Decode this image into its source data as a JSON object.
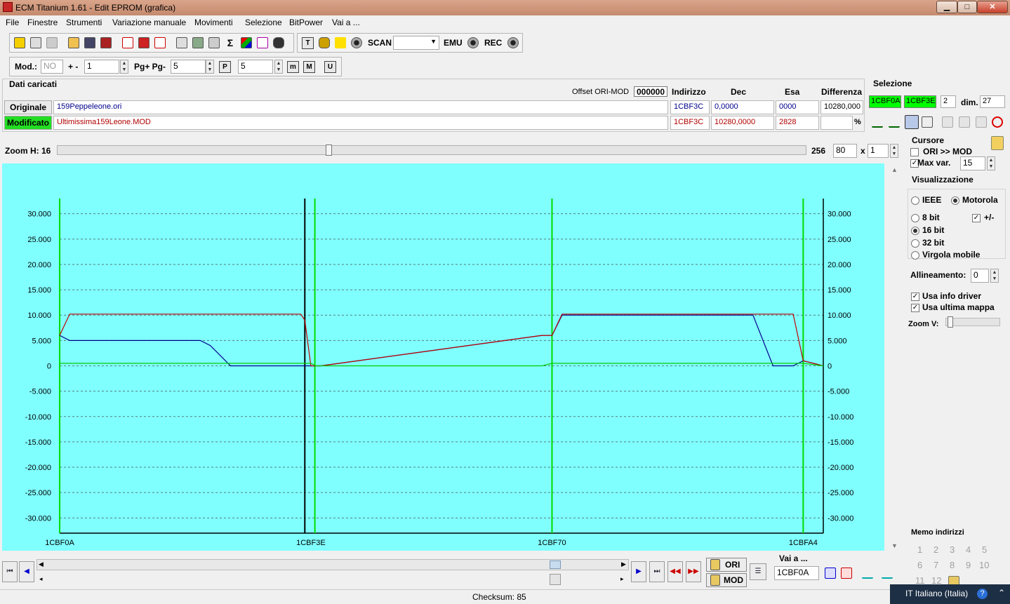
{
  "window": {
    "title": "ECM Titanium 1.61 - Edit EPROM (grafica)",
    "min": "▁",
    "max": "□",
    "close": "✕"
  },
  "menu": [
    "File",
    "Finestre",
    "Strumenti",
    "Variazione manuale",
    "Movimenti",
    "Selezione",
    "BitPower",
    "Vai a ..."
  ],
  "toolbar": {
    "scan": "SCAN",
    "emu": "EMU",
    "rec": "REC"
  },
  "toolbar2": {
    "mod_label": "Mod.:",
    "mod_value": "NO",
    "pm_label": "+ -",
    "pm_value": "1",
    "pg_label": "Pg+ Pg-",
    "pg_value": "5",
    "p_value": "5"
  },
  "dati": {
    "title": "Dati caricati",
    "offset_label": "Offset ORI-MOD",
    "offset_value": "000000",
    "col_indirizzo": "Indirizzo",
    "col_dec": "Dec",
    "col_esa": "Esa",
    "col_diff": "Differenza",
    "originale": {
      "label": "Originale",
      "file": "159Peppeleone.ori",
      "addr": "1CBF3C",
      "dec": "0,0000",
      "esa": "0000",
      "diff": "10280,000"
    },
    "modificato": {
      "label": "Modificato",
      "file": "Ultimissima159Leone.MOD",
      "addr": "1CBF3C",
      "dec": "10280,0000",
      "esa": "2828",
      "diff": "",
      "pct": "%"
    }
  },
  "selezione": {
    "title": "Selezione",
    "from": "1CBF0A",
    "to": "1CBF3E",
    "step": "2",
    "dim_label": "dim.",
    "dim": "27"
  },
  "zoom": {
    "label": "Zoom H: 16",
    "max": "256",
    "value": "80",
    "x": "x",
    "mult": "1",
    "level": 0.36
  },
  "cursore": {
    "title": "Cursore",
    "ori_mod": "ORI >> MOD",
    "ori_mod_checked": false,
    "maxvar": "Max var.",
    "maxvar_checked": true,
    "maxvar_value": "15"
  },
  "visual": {
    "title": "Visualizzazione",
    "ieee": "IEEE",
    "motorola": "Motorola",
    "b8": "8 bit",
    "b16": "16 bit",
    "b32": "32 bit",
    "virgola": "Virgola mobile",
    "pm": "+/-",
    "allineamento": "Allineamento:",
    "allineamento_value": "0",
    "usa_info": "Usa info driver",
    "usa_ultima": "Usa ultima mappa",
    "zoomv": "Zoom V:"
  },
  "memo": {
    "title": "Memo indirizzi",
    "items": [
      "1",
      "2",
      "3",
      "4",
      "5",
      "6",
      "7",
      "8",
      "9",
      "10",
      "11",
      "12"
    ]
  },
  "nav": {
    "ori": "ORI",
    "mod": "MOD",
    "vai_label": "Vai a ...",
    "vai_value": "1CBF0A"
  },
  "status": {
    "checksum": "Checksum: 85"
  },
  "taskbar": {
    "lang": "IT Italiano (Italia)"
  },
  "colors": {
    "graph_bg": "#80ffff",
    "ori": "#00008b",
    "mod": "#c00000",
    "diff": "#00cc00",
    "cursor": "#000000",
    "highlight": "#00ff00"
  },
  "chart_data": {
    "type": "line",
    "y_ticks": [
      30000,
      25000,
      20000,
      15000,
      10000,
      5000,
      0,
      -5000,
      -10000,
      -15000,
      -20000,
      -25000,
      -30000
    ],
    "y_tick_labels": [
      "30.000",
      "25.000",
      "20.000",
      "15.000",
      "10.000",
      "5.000",
      "0",
      "-5.000",
      "-10.000",
      "-15.000",
      "-20.000",
      "-25.000",
      "-30.000"
    ],
    "ylim": [
      -33000,
      33000
    ],
    "xlim": [
      0,
      51
    ],
    "x_tick_positions": [
      0,
      25,
      50
    ],
    "x_labels": [
      {
        "x": 0,
        "label": "1CBF0A"
      },
      {
        "x": 25,
        "label": "1CBF3E"
      },
      {
        "x": 49,
        "label": "1CBF70"
      },
      {
        "x": 74,
        "label": "1CBFA4"
      }
    ],
    "grid": true,
    "series": [
      {
        "key": "ori",
        "points": [
          [
            0,
            6000
          ],
          [
            1,
            5000
          ],
          [
            2,
            5000
          ],
          [
            14,
            5000
          ],
          [
            15,
            4000
          ],
          [
            17,
            0
          ],
          [
            25,
            0
          ],
          [
            25.5,
            0
          ],
          [
            26,
            0
          ],
          [
            48,
            6000
          ],
          [
            49,
            6000
          ],
          [
            50,
            10000
          ],
          [
            69,
            10000
          ],
          [
            71,
            0
          ],
          [
            73,
            0
          ],
          [
            74,
            1000
          ],
          [
            76,
            0
          ]
        ]
      },
      {
        "key": "mod",
        "points": [
          [
            0,
            6000
          ],
          [
            1,
            10200
          ],
          [
            24,
            10200
          ],
          [
            24.4,
            9000
          ],
          [
            25,
            0
          ],
          [
            26,
            0
          ],
          [
            48,
            6000
          ],
          [
            49,
            6000
          ],
          [
            50,
            10200
          ],
          [
            73,
            10200
          ],
          [
            74,
            1000
          ],
          [
            76,
            0
          ]
        ]
      },
      {
        "key": "diff",
        "points": [
          [
            0,
            500
          ],
          [
            25,
            500
          ],
          [
            25.5,
            0
          ],
          [
            26,
            0
          ],
          [
            48,
            0
          ],
          [
            49,
            500
          ],
          [
            74,
            500
          ],
          [
            76,
            0
          ]
        ]
      }
    ],
    "green_markers": [
      0,
      25.4,
      49,
      74
    ],
    "cursor_marker": 24.4
  }
}
